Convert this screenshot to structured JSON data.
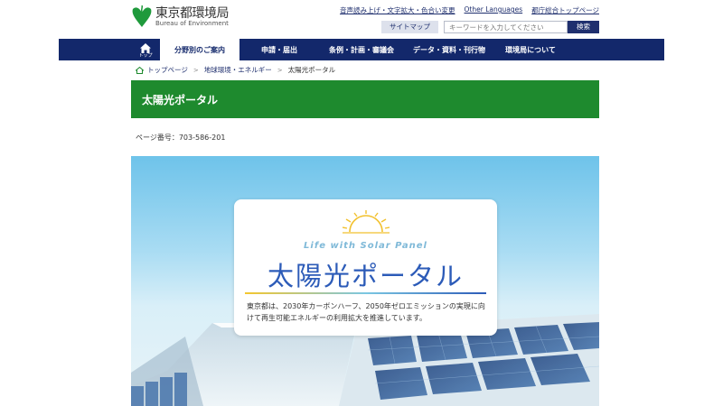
{
  "header": {
    "logo_ja": "東京都環境局",
    "logo_en": "Bureau of Environment",
    "util_links": [
      "音声読み上げ・文字拡大・色合い変更",
      "Other Languages",
      "都庁総合トップページ"
    ],
    "sitemap_label": "サイトマップ",
    "search_placeholder": "キーワードを入力してください",
    "search_button": "検索"
  },
  "nav": {
    "home_label": "トップ",
    "items": [
      "分野別のご案内",
      "申請・届出",
      "条例・計画・審議会",
      "データ・資料・刊行物",
      "環境局について"
    ],
    "active_index": 0
  },
  "breadcrumb": [
    "トップページ",
    "地球環境・エネルギー",
    "太陽光ポータル"
  ],
  "page": {
    "title": "太陽光ポータル",
    "page_number": "ページ番号：703-586-201"
  },
  "hero": {
    "tagline": "Life with Solar Panel",
    "title": "太陽光ポータル",
    "description": "東京都は、2030年カーボンハーフ、2050年ゼロエミッションの実現に向けて再生可能エネルギーの利用拡大を推進しています。"
  },
  "colors": {
    "nav_bg": "#13286b",
    "title_bar": "#1e8a2e",
    "link": "#1f2f6e",
    "hero_title": "#2c5bb8",
    "logo_green": "#1f9a3c"
  }
}
